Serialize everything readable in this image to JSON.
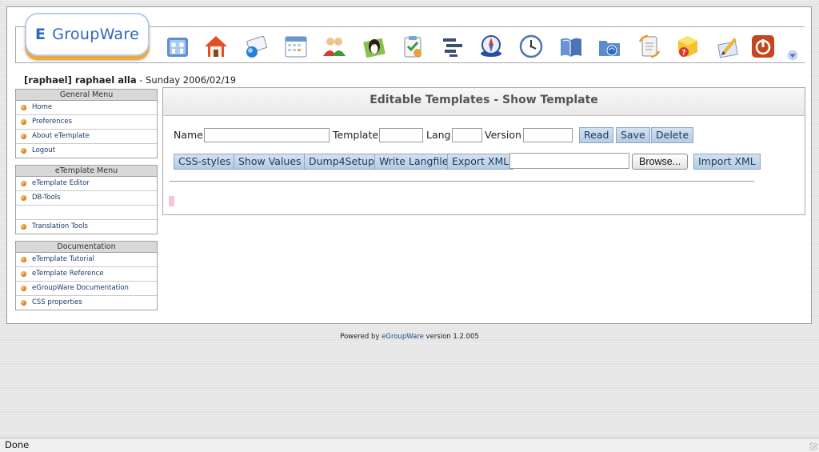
{
  "app": {
    "logo_text": "GroupWare",
    "logo_mark": "E"
  },
  "toolbar": {
    "icons": [
      {
        "name": "admin-icon"
      },
      {
        "name": "home-icon"
      },
      {
        "name": "email-icon"
      },
      {
        "name": "calendar-icon"
      },
      {
        "name": "addressbook-icon"
      },
      {
        "name": "linux-penguin-icon"
      },
      {
        "name": "infolog-icon"
      },
      {
        "name": "projectmanager-icon"
      },
      {
        "name": "compass-icon"
      },
      {
        "name": "timesheet-clock-icon"
      },
      {
        "name": "knowledgebase-icon"
      },
      {
        "name": "filemanager-icon"
      },
      {
        "name": "etemplate-icon"
      },
      {
        "name": "help-icon"
      },
      {
        "name": "preferences-icon"
      },
      {
        "name": "logout-icon"
      },
      {
        "name": "scroll-down-icon"
      }
    ]
  },
  "user": {
    "account": "[raphael] raphael alla",
    "sep": " - ",
    "date": "Sunday 2006/02/19"
  },
  "sidebar": {
    "general": {
      "title": "General Menu",
      "items": [
        "Home",
        "Preferences",
        "About eTemplate",
        "Logout"
      ]
    },
    "etemplate": {
      "title": "eTemplate Menu",
      "items": [
        "eTemplate Editor",
        "DB-Tools",
        "",
        "Translation Tools"
      ]
    },
    "docs": {
      "title": "Documentation",
      "items": [
        "eTemplate Tutorial",
        "eTemplate Reference",
        "eGroupWare Documentation",
        "CSS properties"
      ]
    }
  },
  "main": {
    "title": "Editable Templates - Show Template",
    "fields": {
      "name_label": "Name",
      "template_label": "Template",
      "lang_label": "Lang",
      "version_label": "Version",
      "name_value": "",
      "template_value": "",
      "lang_value": "",
      "version_value": ""
    },
    "buttons": {
      "read": "Read",
      "save": "Save",
      "delete": "Delete",
      "css_styles": "CSS-styles",
      "show_values": "Show Values",
      "dump4setup": "Dump4Setup",
      "write_langfile": "Write Langfile",
      "export_xml": "Export XML",
      "browse": "Browse...",
      "import_xml": "Import XML"
    },
    "file_value": ""
  },
  "footer": {
    "prefix": "Powered by ",
    "link": "eGroupWare",
    "suffix": " version 1.2.005"
  },
  "statusbar": {
    "text": "Done"
  },
  "colors": {
    "button_bg": "#c4d8ea",
    "accent_blue": "#2f66c0",
    "logo_shadow": "#f0a838"
  }
}
